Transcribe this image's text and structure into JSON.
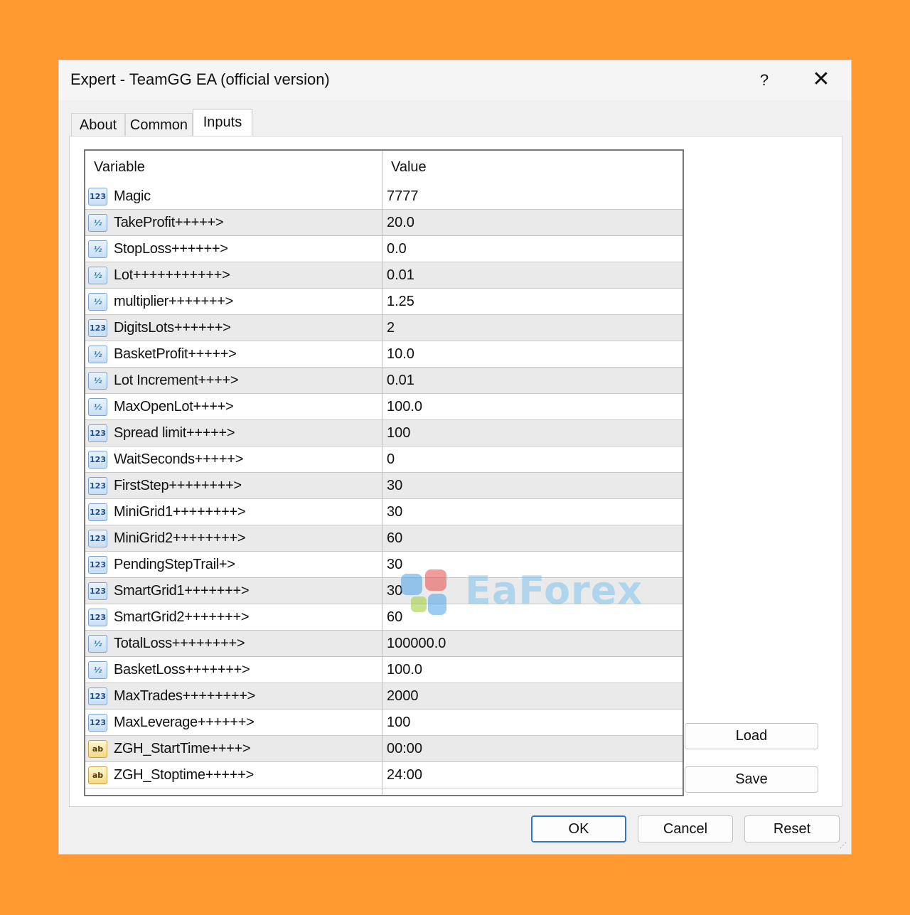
{
  "window": {
    "title": "Expert - TeamGG EA (official version)",
    "help_label": "?",
    "close_label": "✕"
  },
  "tabs": [
    {
      "label": "About"
    },
    {
      "label": "Common"
    },
    {
      "label": "Inputs",
      "active": true
    }
  ],
  "inputs_table": {
    "headers": {
      "variable": "Variable",
      "value": "Value"
    },
    "rows": [
      {
        "type": "int",
        "icon_label": "123",
        "name": "Magic",
        "value": "7777"
      },
      {
        "type": "double",
        "icon_label": "½",
        "name": "TakeProfit+++++>",
        "value": "20.0"
      },
      {
        "type": "double",
        "icon_label": "½",
        "name": "StopLoss++++++>",
        "value": "0.0"
      },
      {
        "type": "double",
        "icon_label": "½",
        "name": "Lot+++++++++++>",
        "value": "0.01"
      },
      {
        "type": "double",
        "icon_label": "½",
        "name": "multiplier+++++++>",
        "value": "1.25"
      },
      {
        "type": "int",
        "icon_label": "123",
        "name": "DigitsLots++++++>",
        "value": "2"
      },
      {
        "type": "double",
        "icon_label": "½",
        "name": "BasketProfit+++++>",
        "value": "10.0"
      },
      {
        "type": "double",
        "icon_label": "½",
        "name": "Lot Increment++++>",
        "value": "0.01"
      },
      {
        "type": "double",
        "icon_label": "½",
        "name": "MaxOpenLot++++>",
        "value": "100.0"
      },
      {
        "type": "int",
        "icon_label": "123",
        "name": "Spread limit+++++>",
        "value": "100"
      },
      {
        "type": "int",
        "icon_label": "123",
        "name": "WaitSeconds+++++>",
        "value": "0"
      },
      {
        "type": "int",
        "icon_label": "123",
        "name": "FirstStep++++++++>",
        "value": "30"
      },
      {
        "type": "int",
        "icon_label": "123",
        "name": "MiniGrid1++++++++>",
        "value": "30"
      },
      {
        "type": "int",
        "icon_label": "123",
        "name": "MiniGrid2++++++++>",
        "value": "60"
      },
      {
        "type": "int",
        "icon_label": "123",
        "name": "PendingStepTrail+>",
        "value": "30"
      },
      {
        "type": "int",
        "icon_label": "123",
        "name": "SmartGrid1+++++++>",
        "value": "30"
      },
      {
        "type": "int",
        "icon_label": "123",
        "name": "SmartGrid2+++++++>",
        "value": "60"
      },
      {
        "type": "double",
        "icon_label": "½",
        "name": "TotalLoss++++++++>",
        "value": "100000.0"
      },
      {
        "type": "double",
        "icon_label": "½",
        "name": "BasketLoss+++++++>",
        "value": "100.0"
      },
      {
        "type": "int",
        "icon_label": "123",
        "name": "MaxTrades++++++++>",
        "value": "2000"
      },
      {
        "type": "int",
        "icon_label": "123",
        "name": "MaxLeverage++++++>",
        "value": "100"
      },
      {
        "type": "string",
        "icon_label": "ab",
        "name": "ZGH_StartTime++++>",
        "value": "00:00"
      },
      {
        "type": "string",
        "icon_label": "ab",
        "name": "ZGH_Stoptime+++++>",
        "value": "24:00"
      }
    ]
  },
  "side_buttons": {
    "load": "Load",
    "save": "Save"
  },
  "footer_buttons": {
    "ok": "OK",
    "cancel": "Cancel",
    "reset": "Reset"
  },
  "watermark": {
    "text": "EaForex"
  },
  "colors": {
    "background": "#FF9A30",
    "dialog": "#F0F0F0",
    "row_alt": "#EAEAEA",
    "primary_border": "#2E74C9"
  }
}
